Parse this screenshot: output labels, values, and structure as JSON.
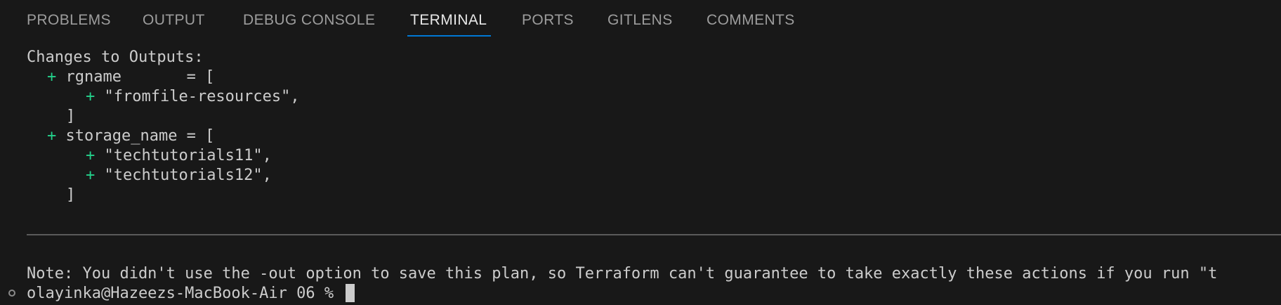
{
  "tabs": [
    {
      "label": "PROBLEMS",
      "active": false
    },
    {
      "label": "OUTPUT",
      "active": false
    },
    {
      "label": "DEBUG CONSOLE",
      "active": false
    },
    {
      "label": "TERMINAL",
      "active": true
    },
    {
      "label": "PORTS",
      "active": false
    },
    {
      "label": "GITLENS",
      "active": false
    },
    {
      "label": "COMMENTS",
      "active": false
    }
  ],
  "terminal": {
    "heading": "Changes to Outputs:",
    "lines": [
      {
        "plus": "+",
        "text": " rgname       = ["
      },
      {
        "plus": "+",
        "text": " \"fromfile-resources\","
      },
      {
        "plus": "",
        "text": "]"
      },
      {
        "plus": "+",
        "text": " storage_name = ["
      },
      {
        "plus": "+",
        "text": " \"techtutorials11\","
      },
      {
        "plus": "+",
        "text": " \"techtutorials12\","
      },
      {
        "plus": "",
        "text": "]"
      }
    ],
    "note": "Note: You didn't use the -out option to save this plan, so Terraform can't guarantee to take exactly these actions if you run \"t",
    "prompt": "olayinka@Hazeezs-MacBook-Air 06 % "
  },
  "colors": {
    "background": "#181818",
    "accent": "#0078d4",
    "plus": "#23d18b"
  }
}
